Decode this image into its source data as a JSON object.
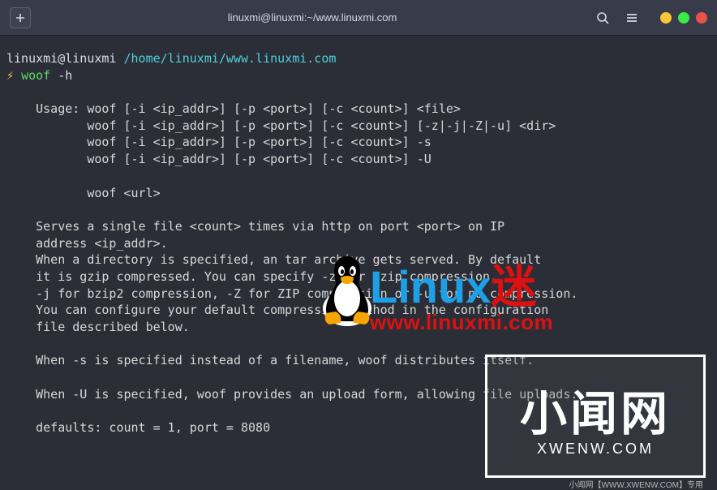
{
  "window": {
    "title": "linuxmi@linuxmi:~/www.linuxmi.com"
  },
  "prompt": {
    "user_host": "linuxmi@linuxmi",
    "path": "/home/linuxmi/www.linuxmi.com",
    "bolt": "⚡",
    "command": "woof",
    "args": "-h"
  },
  "output": {
    "usage_head": "    Usage: woof [-i <ip_addr>] [-p <port>] [-c <count>] <file>",
    "usage2": "           woof [-i <ip_addr>] [-p <port>] [-c <count>] [-z|-j|-Z|-u] <dir>",
    "usage3": "           woof [-i <ip_addr>] [-p <port>] [-c <count>] -s",
    "usage4": "           woof [-i <ip_addr>] [-p <port>] [-c <count>] -U",
    "usage5": "           woof <url>",
    "p1a": "    Serves a single file <count> times via http on port <port> on IP",
    "p1b": "    address <ip_addr>.",
    "p2a": "    When a directory is specified, an tar archive gets served. By default",
    "p2b": "    it is gzip compressed. You can specify -z for gzip compression,",
    "p2c": "    -j for bzip2 compression, -Z for ZIP compression or -u for no compression.",
    "p2d": "    You can configure your default compression method in the configuration",
    "p2e": "    file described below.",
    "p3": "    When -s is specified instead of a filename, woof distributes itself.",
    "p4": "    When -U is specified, woof provides an upload form, allowing file uploads.",
    "p5": "    defaults: count = 1, port = 8080"
  },
  "logo_overlay": {
    "text_blue": "Linux",
    "text_red_cn": "迷",
    "url": "www.linuxmi.com"
  },
  "watermark": {
    "cn": "小闻网",
    "domain": "XWENW.COM",
    "footer": "小闻网【WWW.XWENW.COM】专用"
  }
}
